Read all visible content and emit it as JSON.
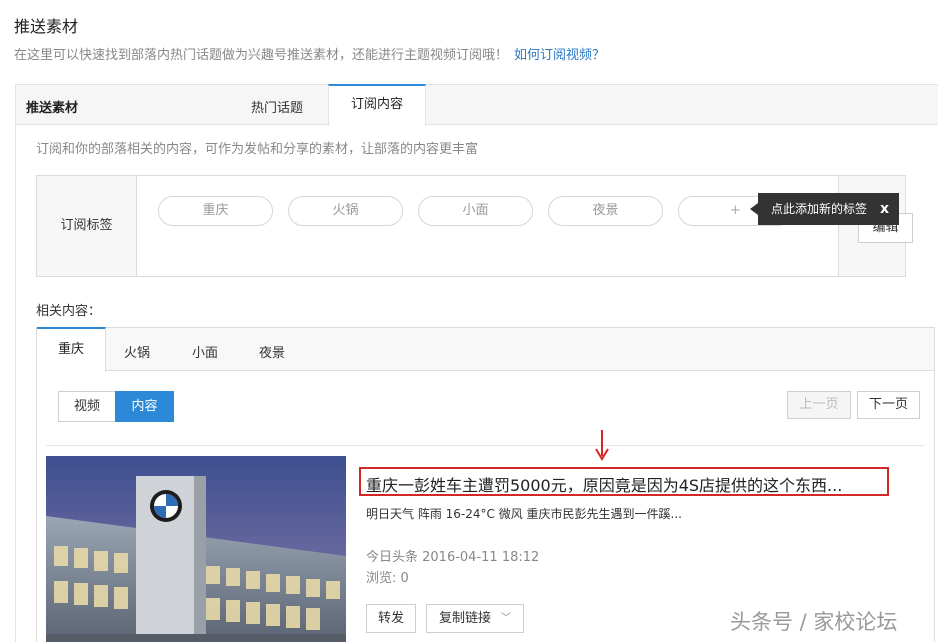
{
  "header": {
    "title": "推送素材",
    "description": "在这里可以快速找到部落内热门话题做为兴趣号推送素材，还能进行主题视频订阅哦！",
    "help_link": "如何订阅视频？"
  },
  "tabs": {
    "section_title": "推送素材",
    "hot_topics": "热门话题",
    "subscriptions": "订阅内容"
  },
  "subscription": {
    "description": "订阅和你的部落相关的内容，可作为发帖和分享的素材，让部落的内容更丰富",
    "tags_label": "订阅标签",
    "tags": [
      "重庆",
      "火锅",
      "小面",
      "夜景"
    ],
    "add_tag": "+",
    "edit_label": "编辑",
    "tooltip": "点此添加新的标签",
    "tooltip_close": "x"
  },
  "related": {
    "label": "相关内容：",
    "tabs": [
      "重庆",
      "火锅",
      "小面",
      "夜景"
    ],
    "filter": {
      "video": "视频",
      "content": "内容"
    },
    "pagination": {
      "prev": "上一页",
      "next": "下一页"
    },
    "article": {
      "title": "重庆一彭姓车主遭罚5000元，原因竟是因为4S店提供的这个东西...",
      "snippet": "明日天气 阵雨 16-24°C 微风 重庆市民彭先生遇到一件蹊...",
      "source": "今日头条 2016-04-11 18:12",
      "views": "浏览: 0",
      "forward_label": "转发",
      "copy_link_label": "复制链接"
    }
  },
  "watermark": "头条号 / 家校论坛",
  "colors": {
    "accent": "#2b89d8",
    "link": "#2b78c5",
    "highlight_red": "#d42727"
  }
}
